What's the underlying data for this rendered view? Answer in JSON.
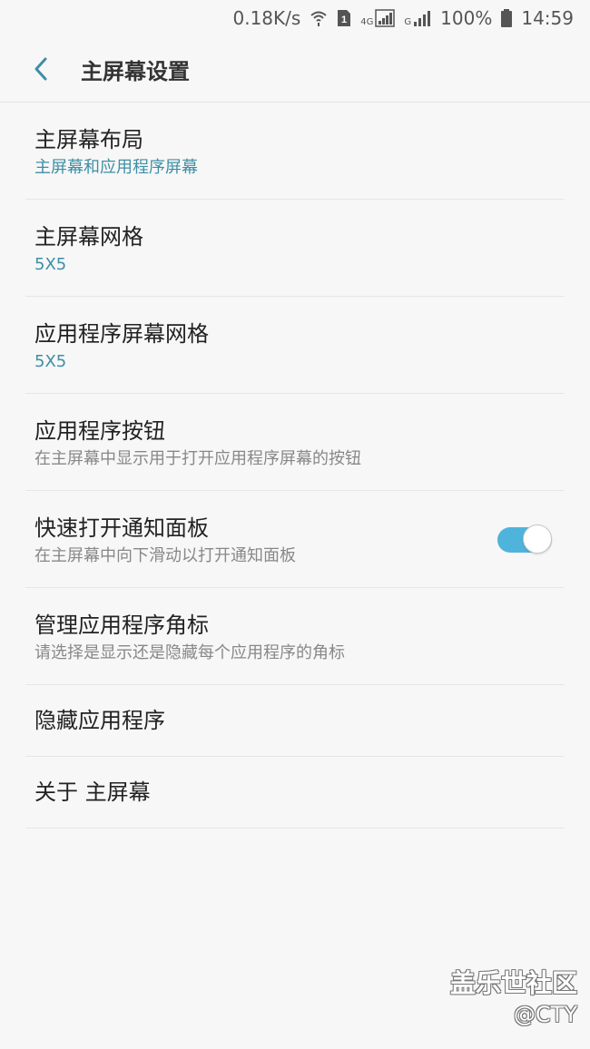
{
  "status_bar": {
    "network_speed": "0.18K/s",
    "sim_badge": "1",
    "net_4g": "4G",
    "net_g": "G",
    "battery": "100%",
    "time": "14:59",
    "icons": [
      "wifi-icon",
      "sim-icon",
      "signal-icon",
      "signal-icon",
      "battery-icon"
    ]
  },
  "header": {
    "title": "主屏幕设置",
    "back_icon": "chevron-left-icon"
  },
  "settings": [
    {
      "title": "主屏幕布局",
      "subtitle": "主屏幕和应用程序屏幕"
    },
    {
      "title": "主屏幕网格",
      "subtitle": "5X5"
    },
    {
      "title": "应用程序屏幕网格",
      "subtitle": "5X5"
    },
    {
      "title": "应用程序按钮",
      "subtitle": "在主屏幕中显示用于打开应用程序屏幕的按钮"
    },
    {
      "title": "快速打开通知面板",
      "subtitle": "在主屏幕中向下滑动以打开通知面板",
      "toggle_on": true
    },
    {
      "title": "管理应用程序角标",
      "subtitle": "请选择是显示还是隐藏每个应用程序的角标"
    },
    {
      "title": "隐藏应用程序"
    },
    {
      "title": "关于 主屏幕"
    }
  ],
  "watermark": {
    "line1": "盖乐世社区",
    "line2": "@CTY"
  },
  "colors": {
    "accent_text": "#3d8fa6",
    "toggle_on": "#4fb4dc",
    "background": "#f7f7f7"
  }
}
